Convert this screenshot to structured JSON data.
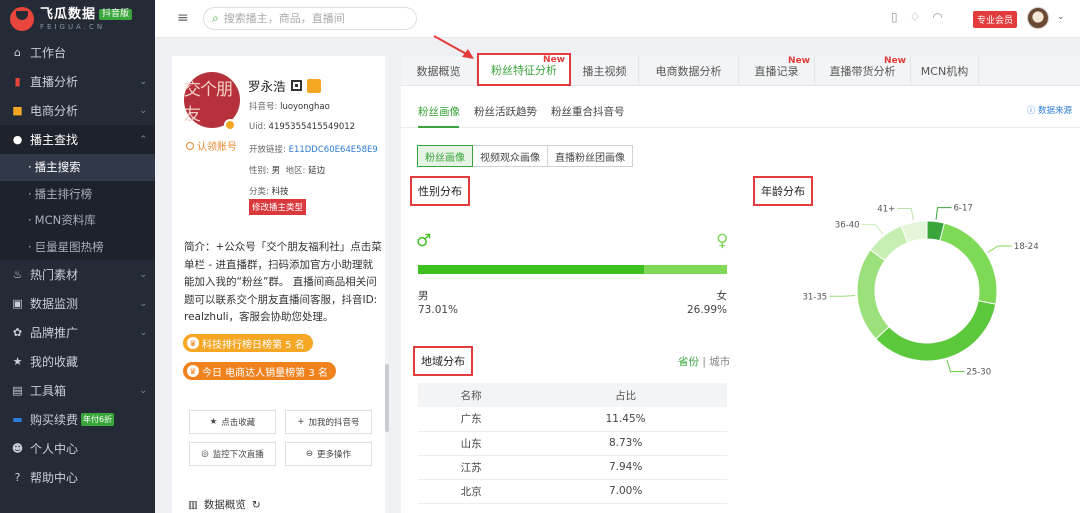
{
  "brand": {
    "name": "飞瓜数据",
    "badge": "抖音版",
    "sub": "FEIGUA.CN"
  },
  "sidebar": {
    "items": [
      {
        "label": "工作台",
        "icon": "home-icon"
      },
      {
        "label": "直播分析",
        "icon": "live-chart-icon"
      },
      {
        "label": "电商分析",
        "icon": "shopping-bag-icon"
      },
      {
        "label": "播主查找",
        "icon": "search-icon"
      },
      {
        "label": "热门素材",
        "icon": "fire-icon"
      },
      {
        "label": "数据监测",
        "icon": "monitor-icon"
      },
      {
        "label": "品牌推广",
        "icon": "brand-icon"
      },
      {
        "label": "我的收藏",
        "icon": "star-icon"
      },
      {
        "label": "工具箱",
        "icon": "toolbox-icon"
      },
      {
        "label": "购买续费",
        "icon": "card-icon",
        "badge": "年付6折"
      },
      {
        "label": "个人中心",
        "icon": "user-icon"
      },
      {
        "label": "帮助中心",
        "icon": "help-icon"
      }
    ],
    "subitems": [
      "播主搜索",
      "播主排行榜",
      "MCN资料库",
      "巨量星图热榜"
    ]
  },
  "topbar": {
    "search_placeholder": "搜索播主，商品，直播间",
    "vip_label": "专业会员"
  },
  "profile": {
    "avatar_text": "交个朋友",
    "name": "罗永浩",
    "claim": "认领账号",
    "douyin_label": "抖音号:",
    "douyin": "luoyonghao",
    "uid_label": "Uid:",
    "uid": "4195355415549012",
    "link_label": "开放链接:",
    "link": "E11DDC60E64E58E9",
    "gender_label": "性别:",
    "gender": "男",
    "region_label": "地区:",
    "region": "延边",
    "category_label": "分类:",
    "category": "科技",
    "edit_type": "修改播主类型",
    "intro": "简介：+公众号「交个朋友福利社」点击菜单栏 - 进直播群，扫码添加官方小助理就能加入我的“粉丝”群。 直播间商品相关问题可以联系交个朋友直播间客服，抖音ID: realzhuli，客服会协助您处理。",
    "rank1": "科技排行榜日榜第 5 名",
    "rank2": "今日 电商达人销量榜第 3 名",
    "actions": [
      "点击收藏",
      "加我的抖音号",
      "监控下次直播",
      "更多操作"
    ],
    "overview": "数据概览"
  },
  "main": {
    "tabs": [
      {
        "label": "数据概览",
        "new": ""
      },
      {
        "label": "粉丝特征分析",
        "new": "New"
      },
      {
        "label": "播主视频",
        "new": ""
      },
      {
        "label": "电商数据分析",
        "new": ""
      },
      {
        "label": "直播记录",
        "new": "New"
      },
      {
        "label": "直播带货分析",
        "new": "New"
      },
      {
        "label": "MCN机构",
        "new": ""
      }
    ],
    "subtabs": [
      "粉丝画像",
      "粉丝活跃趋势",
      "粉丝重合抖音号"
    ],
    "data_source": "数据来源",
    "segments": [
      "粉丝画像",
      "视频观众画像",
      "直播粉丝团画像"
    ],
    "gender_title": "性别分布",
    "male_label": "男",
    "female_label": "女",
    "male_pct": "73.01%",
    "female_pct": "26.99%",
    "male_fraction": 0.7301,
    "age_title": "年龄分布",
    "region_title": "地域分布",
    "region_toggle": {
      "province": "省份",
      "sep": "|",
      "city": "城市"
    },
    "region_table": {
      "headers": [
        "名称",
        "占比"
      ],
      "rows": [
        [
          "广东",
          "11.45%"
        ],
        [
          "山东",
          "8.73%"
        ],
        [
          "江苏",
          "7.94%"
        ],
        [
          "北京",
          "7.00%"
        ]
      ]
    }
  },
  "chart_data": {
    "type": "pie",
    "title": "年龄分布",
    "categories": [
      "6-17",
      "18-24",
      "25-30",
      "31-35",
      "36-40",
      "41+"
    ],
    "values": [
      4,
      24,
      35,
      22,
      9,
      6
    ],
    "colors": [
      "#3aa53a",
      "#7ed957",
      "#5cc93c",
      "#9be07a",
      "#c6eeb2",
      "#e3f6d8"
    ]
  }
}
